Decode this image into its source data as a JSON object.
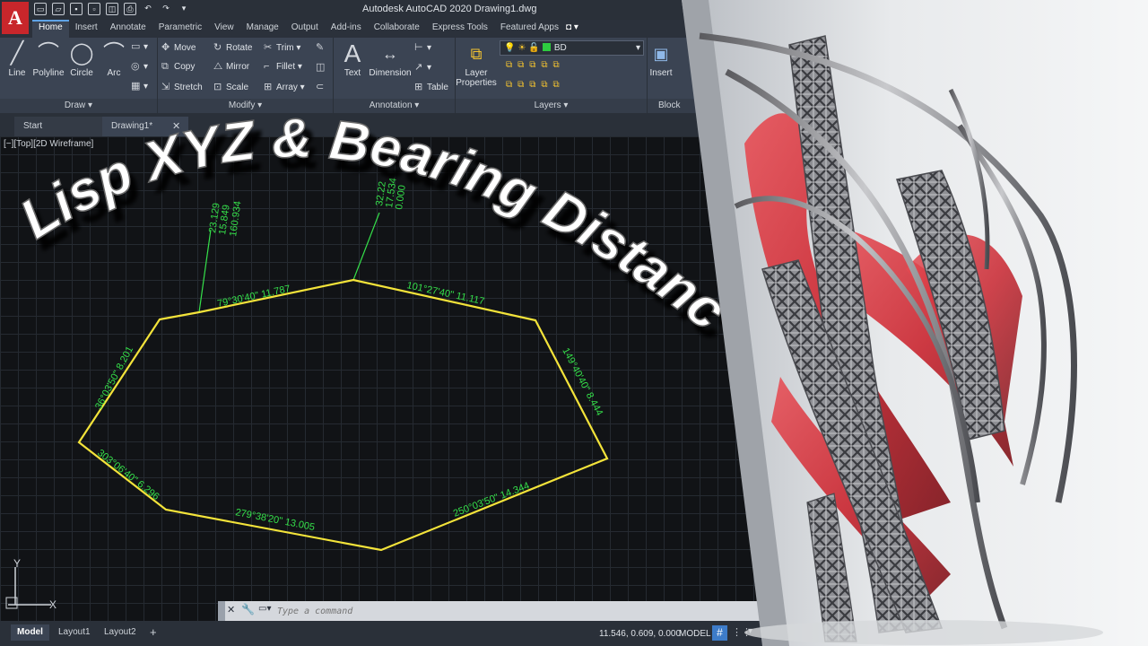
{
  "window": {
    "title": "Autodesk AutoCAD 2020    Drawing1.dwg",
    "logo": "A"
  },
  "ribbon_tabs": [
    "Home",
    "Insert",
    "Annotate",
    "Parametric",
    "View",
    "Manage",
    "Output",
    "Add-ins",
    "Collaborate",
    "Express Tools",
    "Featured Apps"
  ],
  "panels": {
    "draw": {
      "title": "Draw ▾",
      "tools": [
        "Line",
        "Polyline",
        "Circle",
        "Arc"
      ]
    },
    "modify": {
      "title": "Modify ▾",
      "tools": [
        "Move",
        "Rotate",
        "Trim",
        "Copy",
        "Mirror",
        "Fillet",
        "Stretch",
        "Scale",
        "Array"
      ]
    },
    "annotation": {
      "title": "Annotation ▾",
      "tools": [
        "Text",
        "Dimension",
        "Table"
      ]
    },
    "layers": {
      "title": "Layers ▾",
      "layer_properties_label": "Layer Properties",
      "current_layer": "BD"
    },
    "block": {
      "title": "Block",
      "insert_label": "Insert"
    }
  },
  "file_tabs": {
    "start": "Start",
    "drawing": "Drawing1*",
    "close": "✕"
  },
  "viewport": {
    "label": "[−][Top][2D Wireframe]"
  },
  "overlay": {
    "title": "Lisp XYZ & Bearing Distance"
  },
  "drawing": {
    "segments": [
      "79°30'40\" 11.787",
      "101°27'40\" 11.117",
      "149°40'40\" 8.444",
      "250°03'50\" 14.344",
      "279°38'20\" 13.005",
      "303°06'40\" 6.296",
      "36°03'50\" 8.201"
    ],
    "point_labels": [
      [
        "23.129",
        "15.849",
        "160.934"
      ],
      [
        "32.22",
        "17.534",
        "0.000"
      ]
    ]
  },
  "ucs": {
    "y_label": "Y",
    "x_label": "X"
  },
  "command_line": {
    "placeholder": "Type a command"
  },
  "status_bar": {
    "tabs": [
      "Model",
      "Layout1",
      "Layout2"
    ],
    "add_tab": "+",
    "coordinates": "11.546, 0.609, 0.000",
    "mode": "MODEL"
  },
  "colors": {
    "polyline": "#f3e33a",
    "annotation_text": "#35e04a",
    "logo_red": "#c8262b",
    "grid_active": "#3d7cc9",
    "sculpture_red": "#c9252f"
  },
  "icons": {
    "new": "new-file-icon",
    "open": "open-folder-icon",
    "save": "save-icon",
    "print": "print-icon",
    "undo": "undo-icon",
    "redo": "redo-icon"
  }
}
